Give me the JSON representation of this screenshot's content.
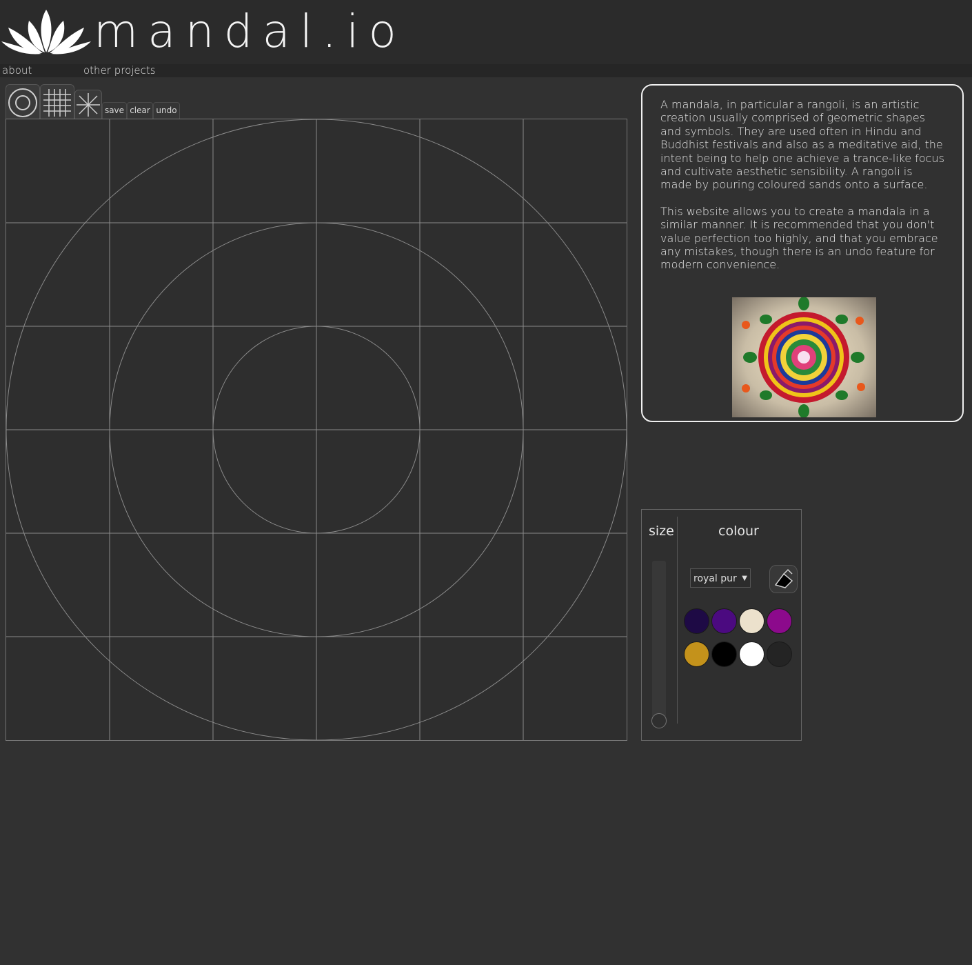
{
  "header": {
    "logo_text": "mandal.io"
  },
  "nav": {
    "items": [
      "about",
      "other projects"
    ]
  },
  "toolbar": {
    "save": "save",
    "clear": "clear",
    "undo": "undo"
  },
  "info": {
    "paragraphs": [
      "A mandala, in particular a rangoli, is an artistic creation usually comprised of geometric shapes and symbols. They are used often in Hindu and Buddhist festivals and also as a meditative aid, the intent being to help one achieve a trance-like focus and cultivate aesthetic sensibility. A rangoli is made by pouring coloured sands onto a surface.",
      "This website allows you to create a mandala in a similar manner. It is recommended that you don't value perfection too highly, and that you embrace any mistakes, though there is an undo feature for modern convenience."
    ]
  },
  "panel": {
    "size_label": "size",
    "colour_label": "colour",
    "selected_colour": "royal pur",
    "swatches": [
      "#1e0a45",
      "#4b0a80",
      "#ece1cc",
      "#8c0a8c",
      "#c4921b",
      "#000000",
      "#ffffff",
      "#242424"
    ]
  },
  "colors": {
    "background": "#313131",
    "header": "#2b2b2b",
    "nav": "#262626",
    "grid": "#8a8a8a"
  }
}
